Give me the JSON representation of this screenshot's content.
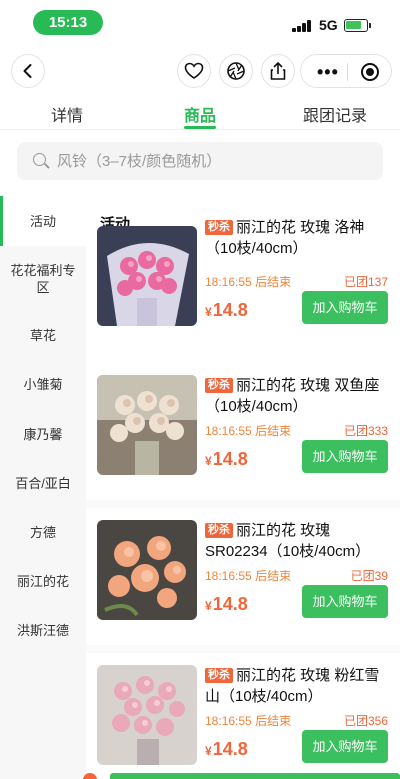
{
  "status_bar": {
    "time": "15:13",
    "network": "5G",
    "colors": {
      "pill": "#27ba55",
      "battery": "#3fc25a"
    }
  },
  "nav": {
    "back_icon": "chevron-left-icon",
    "favorite_icon": "heart-icon",
    "aperture_icon": "aperture-icon",
    "share_icon": "share-icon",
    "more_icon": "more-dots-icon",
    "miniapp_icon": "target-icon"
  },
  "tabs": [
    {
      "label": "详情",
      "active": false
    },
    {
      "label": "商品",
      "active": true
    },
    {
      "label": "跟团记录",
      "active": false
    }
  ],
  "search": {
    "placeholder": "风铃（3–7枝/颜色随机）"
  },
  "sidebar": {
    "items": [
      {
        "label": "活动",
        "active": true
      },
      {
        "label": "花花福利专区"
      },
      {
        "label": "草花"
      },
      {
        "label": "小雏菊"
      },
      {
        "label": "康乃馨"
      },
      {
        "label": "百合/亚白"
      },
      {
        "label": "方德"
      },
      {
        "label": "丽江的花"
      },
      {
        "label": "洪斯汪德"
      }
    ]
  },
  "section_title": "活动",
  "products": [
    {
      "tag": "秒杀",
      "name": "丽江的花 玫瑰 洛神（10枝/40cm）",
      "countdown": "18:16:55",
      "countdown_suffix": "后结束",
      "joined": "已团137",
      "currency": "¥",
      "price": "14.8",
      "button": "加入购物车",
      "image": "pink-rose-bouquet"
    },
    {
      "tag": "秒杀",
      "name": "丽江的花 玫瑰 双鱼座（10枝/40cm）",
      "countdown": "18:16:55",
      "countdown_suffix": "后结束",
      "joined": "已团333",
      "currency": "¥",
      "price": "14.8",
      "button": "加入购物车",
      "image": "cream-rose-bouquet"
    },
    {
      "tag": "秒杀",
      "name": "丽江的花 玫瑰 SR02234（10枝/40cm）",
      "countdown": "18:16:55",
      "countdown_suffix": "后结束",
      "joined": "已团39",
      "currency": "¥",
      "price": "14.8",
      "button": "加入购物车",
      "image": "peach-rose-bouquet"
    },
    {
      "tag": "秒杀",
      "name": "丽江的花 玫瑰 粉红雪山（10枝/40cm）",
      "countdown": "18:16:55",
      "countdown_suffix": "后结束",
      "joined": "已团356",
      "currency": "¥",
      "price": "14.8",
      "button": "加入购物车",
      "image": "light-pink-rose-bouquet"
    }
  ],
  "colors": {
    "accent": "#27ba55",
    "price": "#f0653a",
    "countdown": "#f0853a",
    "button": "#3cbf5f"
  }
}
